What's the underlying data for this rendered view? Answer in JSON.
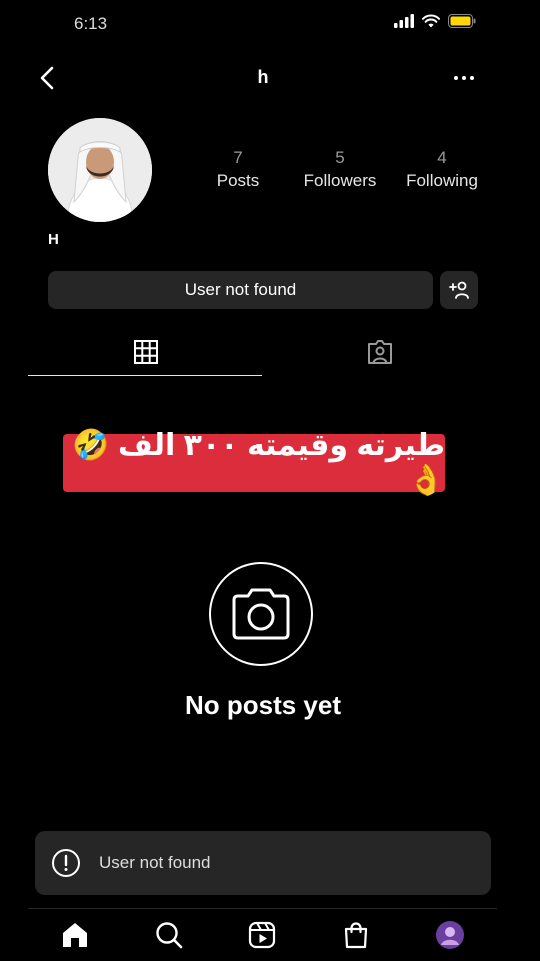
{
  "status_bar": {
    "time": "6:13"
  },
  "header": {
    "title": "h"
  },
  "profile": {
    "name": "H",
    "stats": [
      {
        "value": "7",
        "label": "Posts"
      },
      {
        "value": "5",
        "label": "Followers"
      },
      {
        "value": "4",
        "label": "Following"
      }
    ]
  },
  "actions": {
    "main_button": "User not found"
  },
  "banner": {
    "text": "طيرته وقيمته ٣٠٠ الف 🤣👌"
  },
  "empty_state": {
    "text": "No posts yet"
  },
  "toast": {
    "text": "User not found"
  },
  "colors": {
    "background": "#000000",
    "surface": "#262626",
    "banner": "#dc2d3c"
  }
}
